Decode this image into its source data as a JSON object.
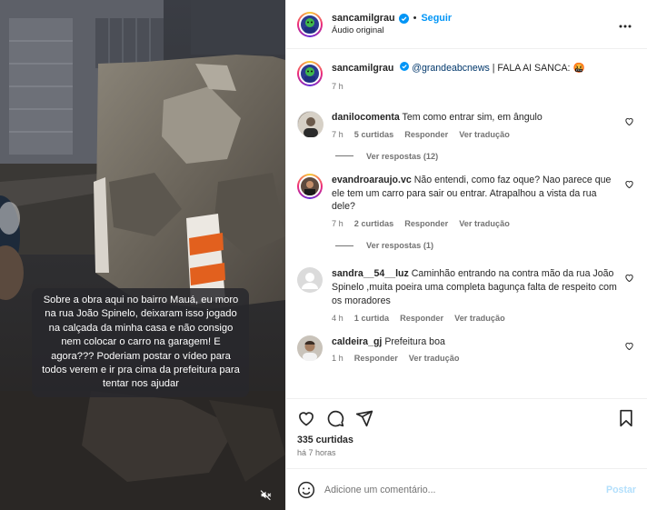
{
  "video": {
    "caption": "Sobre a obra aqui no bairro Mauá, eu moro na rua João Spinelo, deixaram isso jogado na calçada da minha casa e não consigo nem colocar o carro na garagem! E agora??? Poderiam postar o vídeo para todos verem e ir pra cima da prefeitura para tentar nos ajudar",
    "mute_icon": "speaker-muted-icon"
  },
  "header": {
    "username": "sancamilgrau",
    "follow_label": "Seguir",
    "dot": "•",
    "subtitle": "Áudio original",
    "more_icon": "more-horizontal-icon"
  },
  "caption_post": {
    "username": "sancamilgrau",
    "mention": "@grandeabcnews",
    "text": " | FALA AI SANCA: 🤬",
    "time": "7 h"
  },
  "comments": [
    {
      "username": "danilocomenta",
      "text": "Tem como entrar sim, em ângulo",
      "time": "7 h",
      "likes": "5 curtidas",
      "reply": "Responder",
      "translate": "Ver tradução",
      "replies": "Ver respostas (12)"
    },
    {
      "username": "evandroaraujo.vc",
      "text": "Não entendi, como faz oque? Nao parece que ele tem um carro para sair ou entrar. Atrapalhou a vista da rua dele?",
      "time": "7 h",
      "likes": "2 curtidas",
      "reply": "Responder",
      "translate": "Ver tradução",
      "replies": "Ver respostas (1)"
    },
    {
      "username": "sandra__54__luz",
      "text": "Caminhão entrando na contra mão da rua João Spinelo ,muita poeira uma completa bagunça falta de respeito com os moradores",
      "time": "4 h",
      "likes": "1 curtida",
      "reply": "Responder",
      "translate": "Ver tradução"
    },
    {
      "username": "caldeira_gj",
      "text": "Prefeitura boa",
      "time": "1 h",
      "reply": "Responder",
      "translate": "Ver tradução"
    }
  ],
  "actions": {
    "likes": "335 curtidas",
    "time": "há 7 horas",
    "comment_placeholder": "Adicione um comentário...",
    "post_label": "Postar"
  },
  "colors": {
    "link": "#0095f6",
    "mention": "#00376b",
    "secondary_text": "#737373",
    "post_disabled": "#b2dffc"
  }
}
